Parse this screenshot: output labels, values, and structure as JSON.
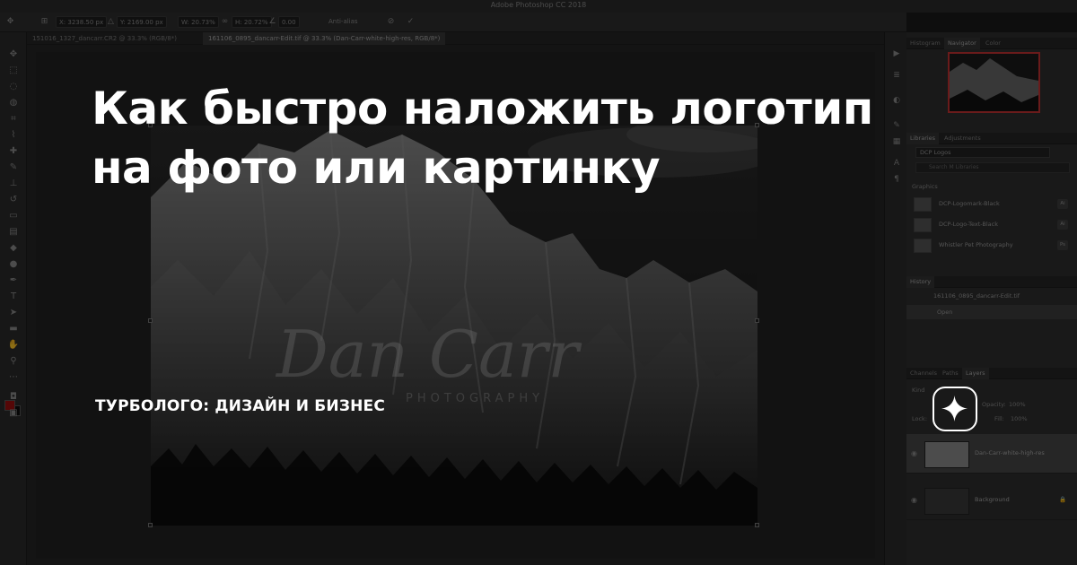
{
  "app": {
    "window_title": "Adobe Photoshop CC 2018"
  },
  "options_bar": {
    "x_value": "X: 3238.50 px",
    "y_value": "Y: 2169.00 px",
    "w_value": "W: 20.73%",
    "h_value": "H: 20.72%",
    "angle_value": "0.00",
    "antialias_label": "Anti-alias"
  },
  "document_tabs": [
    {
      "label": "151016_1327_dancarr.CR2 @ 33.3% (RGB/8*)"
    },
    {
      "label": "161106_0895_dancarr-Edit.tif @ 33.3% (Dan-Carr-white-high-res, RGB/8*)"
    }
  ],
  "panels": {
    "top_tabs": [
      "Histogram",
      "Navigator",
      "Color"
    ],
    "library_tabs": [
      "Libraries",
      "Adjustments"
    ],
    "library_name": "DCP Logos",
    "library_search_placeholder": "Search M Libraries",
    "graphics_section": "Graphics",
    "graphics": [
      {
        "name": "DCP-Logomark-Black",
        "badge": "Ai"
      },
      {
        "name": "DCP-Logo-Text-Black",
        "badge": "Ai"
      },
      {
        "name": "Whistler Pet Photography",
        "badge": "Ps"
      }
    ],
    "history_tab": "History",
    "history": [
      {
        "label": "161106_0895_dancarr-Edit.tif"
      },
      {
        "label": "Open"
      }
    ],
    "layers_tabs": [
      "Channels",
      "Paths",
      "Layers"
    ],
    "layers_kind": "Kind",
    "opacity_label": "Opacity:",
    "opacity_value": "100%",
    "fill_label": "Fill:",
    "fill_value": "100%",
    "lock_label": "Lock:",
    "layers": [
      {
        "name": "Dan-Carr-white-high-res"
      },
      {
        "name": "Background"
      }
    ]
  },
  "colors": {
    "foreground_swatch": "#9b0d0d",
    "navigator_frame": "#c23232",
    "headline_text": "#ffffff"
  },
  "watermark": {
    "script_text": "Dan Carr",
    "sub_text": "PHOTOGRAPHY"
  },
  "article": {
    "title_line_1": "Как быстро наложить логотип",
    "title_line_2": "на фото или картинку",
    "publisher": "ТУРБОЛОГО: ДИЗАЙН И БИЗНЕС"
  },
  "icons": {
    "brand_logo": "sparkle-icon"
  }
}
